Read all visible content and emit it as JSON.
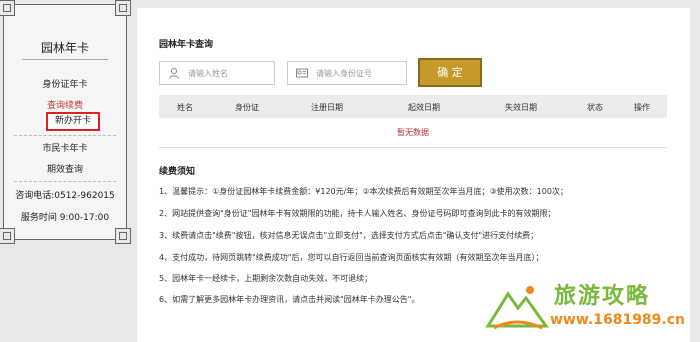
{
  "sidebar": {
    "title": "园林年卡",
    "items": [
      {
        "label": "身份证年卡"
      },
      {
        "label": "查询续费"
      },
      {
        "label": "新办开卡"
      },
      {
        "label": "市民卡年卡"
      },
      {
        "label": "期效查询"
      },
      {
        "label": "咨询电话:0512-962015"
      },
      {
        "label": "服务时间  9:00-17:00"
      }
    ]
  },
  "main": {
    "title": "园林年卡查询",
    "name_field": {
      "placeholder": "请输入姓名",
      "icon": "user-icon"
    },
    "id_field": {
      "placeholder": "请输入身份证号",
      "icon": "id-card-icon"
    },
    "confirm_label": "确 定",
    "table": {
      "headers": [
        "姓名",
        "身份证",
        "注册日期",
        "起效日期",
        "失效日期",
        "状态",
        "操作"
      ],
      "empty_text": "暂无数据"
    },
    "notice": {
      "title": "续费须知",
      "items": [
        "1、温馨提示：①身份证园林年卡续费金额：¥120元/年；②本次续费后有效期至次年当月底；③使用次数：100次；",
        "2、网站提供查询\"身份证\"园林年卡有效期限的功能，持卡人输入姓名、身份证号码即可查询到此卡的有效期限；",
        "3、续费请点击\"续费\"按钮，核对信息无误点击\"立即支付\"，选择支付方式后点击\"确认支付\"进行支付续费；",
        "4、支付成功，待网页跳转\"续费成功\"后，您可以自行返回当前查询页面核实有效期（有效期至次年当月底）；",
        "5、园林年卡一经续卡，上期剩余次数自动失效，不可退续；",
        "6、如需了解更多园林年卡办理资讯，请点击并阅读\"园林年卡办理公告\"。"
      ]
    }
  },
  "watermark": {
    "name": "旅游攻略",
    "url": "www.1681989.cn"
  },
  "colors": {
    "accent_gold": "#c59a2a",
    "link_red": "#c73a3a",
    "highlight_box": "#e02020",
    "watermark_green": "#7ab83c"
  }
}
